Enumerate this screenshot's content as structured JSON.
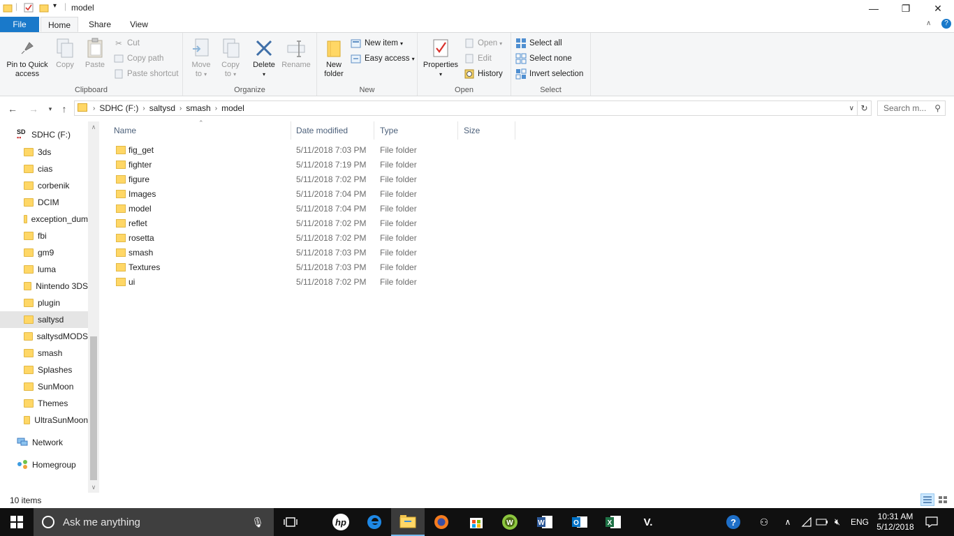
{
  "window": {
    "title": "model",
    "controls": {
      "minimize": "—",
      "restore": "❐",
      "close": "✕"
    }
  },
  "tabs": [
    "File",
    "Home",
    "Share",
    "View"
  ],
  "ribbon": {
    "clipboard": {
      "label": "Clipboard",
      "pin": "Pin to Quick access",
      "pin_l1": "Pin to Quick",
      "pin_l2": "access",
      "copy": "Copy",
      "paste": "Paste",
      "cut": "Cut",
      "copy_path": "Copy path",
      "paste_shortcut": "Paste shortcut"
    },
    "organize": {
      "label": "Organize",
      "move_l1": "Move",
      "move_l2": "to",
      "copy_l1": "Copy",
      "copy_l2": "to",
      "delete": "Delete",
      "rename": "Rename"
    },
    "new": {
      "label": "New",
      "folder_l1": "New",
      "folder_l2": "folder",
      "new_item": "New item",
      "easy_access": "Easy access"
    },
    "open": {
      "label": "Open",
      "properties": "Properties",
      "open": "Open",
      "edit": "Edit",
      "history": "History"
    },
    "select": {
      "label": "Select",
      "select_all": "Select all",
      "select_none": "Select none",
      "invert": "Invert selection"
    }
  },
  "address": {
    "crumbs": [
      "SDHC (F:)",
      "saltysd",
      "smash",
      "model"
    ],
    "search_placeholder": "Search m..."
  },
  "navpane": {
    "drive": "SDHC (F:)",
    "folders": [
      "3ds",
      "cias",
      "corbenik",
      "DCIM",
      "exception_dum",
      "fbi",
      "gm9",
      "luma",
      "Nintendo 3DS",
      "plugin",
      "saltysd",
      "saltysdMODS",
      "smash",
      "Splashes",
      "SunMoon",
      "Themes",
      "UltraSunMoon"
    ],
    "selected": "saltysd",
    "network": "Network",
    "homegroup": "Homegroup"
  },
  "columns": {
    "name": "Name",
    "date": "Date modified",
    "type": "Type",
    "size": "Size"
  },
  "files": [
    {
      "name": "fig_get",
      "date": "5/11/2018 7:03 PM",
      "type": "File folder"
    },
    {
      "name": "fighter",
      "date": "5/11/2018 7:19 PM",
      "type": "File folder"
    },
    {
      "name": "figure",
      "date": "5/11/2018 7:02 PM",
      "type": "File folder"
    },
    {
      "name": "Images",
      "date": "5/11/2018 7:04 PM",
      "type": "File folder"
    },
    {
      "name": "model",
      "date": "5/11/2018 7:04 PM",
      "type": "File folder"
    },
    {
      "name": "reflet",
      "date": "5/11/2018 7:02 PM",
      "type": "File folder"
    },
    {
      "name": "rosetta",
      "date": "5/11/2018 7:02 PM",
      "type": "File folder"
    },
    {
      "name": "smash",
      "date": "5/11/2018 7:03 PM",
      "type": "File folder"
    },
    {
      "name": "Textures",
      "date": "5/11/2018 7:03 PM",
      "type": "File folder"
    },
    {
      "name": "ui",
      "date": "5/11/2018 7:02 PM",
      "type": "File folder"
    }
  ],
  "status": {
    "count": "10 items"
  },
  "taskbar": {
    "search_placeholder": "Ask me anything",
    "lang": "ENG",
    "time": "10:31 AM",
    "date": "5/12/2018"
  },
  "colors": {
    "accent": "#1979ca",
    "folder": "#ffd766",
    "taskbar": "#101010"
  }
}
